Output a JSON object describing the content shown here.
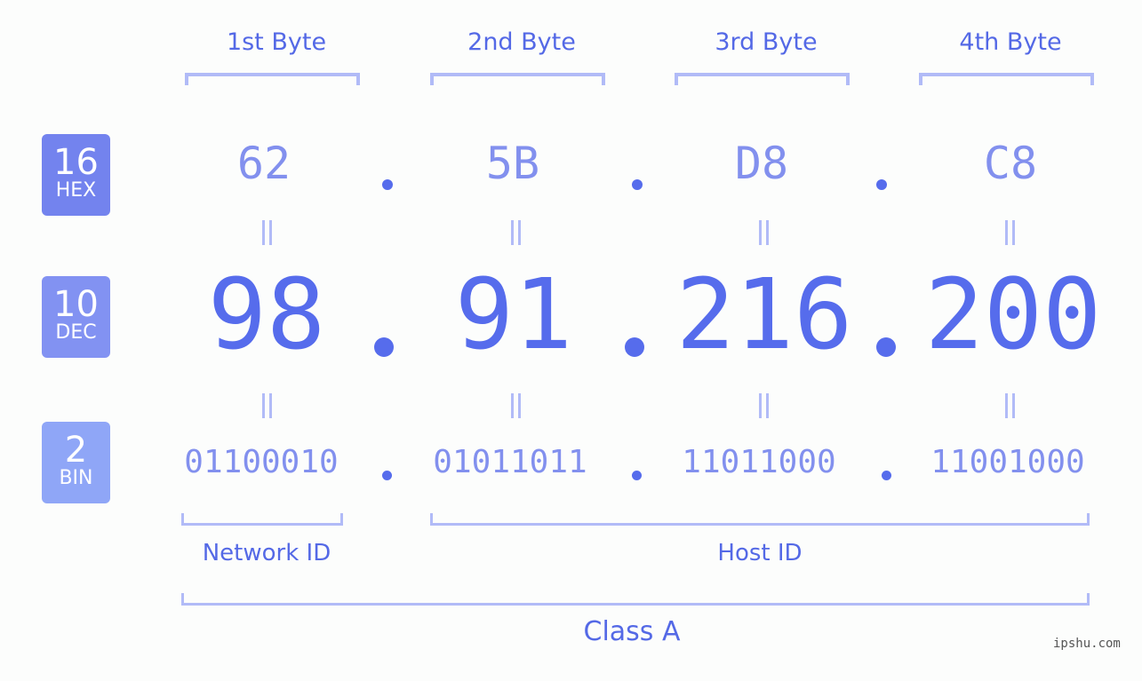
{
  "bytes": [
    {
      "label": "1st Byte",
      "hex": "62",
      "dec": "98",
      "bin": "01100010"
    },
    {
      "label": "2nd Byte",
      "hex": "5B",
      "dec": "91",
      "bin": "01011011"
    },
    {
      "label": "3rd Byte",
      "hex": "D8",
      "dec": "216",
      "bin": "11011000"
    },
    {
      "label": "4th Byte",
      "hex": "C8",
      "dec": "200",
      "bin": "11001000"
    }
  ],
  "separator": ".",
  "badges": {
    "hex": {
      "num": "16",
      "base": "HEX",
      "color": "#7383ee"
    },
    "dec": {
      "num": "10",
      "base": "DEC",
      "color": "#8292f2"
    },
    "bin": {
      "num": "2",
      "base": "BIN",
      "color": "#8fa6f7"
    }
  },
  "network_label": "Network ID",
  "host_label": "Host ID",
  "class_label": "Class A",
  "watermark": "ipshu.com",
  "colors": {
    "accent": "#566cec",
    "bracket": "#b1bbf7",
    "light": "#8290ee"
  }
}
